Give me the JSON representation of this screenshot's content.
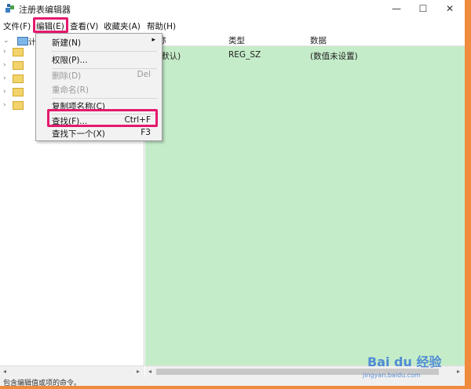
{
  "window": {
    "title": "注册表编辑器",
    "controls": {
      "minimize": "—",
      "maximize": "☐",
      "close": "✕"
    }
  },
  "menubar": {
    "file": "文件(F)",
    "edit": "编辑(E)",
    "view": "查看(V)",
    "favorites": "收藏夹(A)",
    "help": "帮助(H)"
  },
  "tree": {
    "root_label": "计",
    "expand_glyph": "›",
    "collapse_glyph": "⌄"
  },
  "list": {
    "headers": {
      "name": "称",
      "type": "类型",
      "data": "数据"
    },
    "rows": [
      {
        "name": "(默认)",
        "type": "REG_SZ",
        "data": "(数值未设置)"
      }
    ]
  },
  "edit_menu": {
    "items": [
      {
        "label": "新建(N)",
        "shortcut": "",
        "submenu_glyph": "▸"
      },
      {
        "label": "权限(P)...",
        "shortcut": ""
      },
      {
        "label": "删除(D)",
        "shortcut": "Del"
      },
      {
        "label": "重命名(R)",
        "shortcut": ""
      },
      {
        "label": "复制项名称(C)",
        "shortcut": ""
      },
      {
        "label": "查找(F)...",
        "shortcut": "Ctrl+F"
      },
      {
        "label": "查找下一个(X)",
        "shortcut": "F3"
      }
    ]
  },
  "scroll_arrows": {
    "left": "◂",
    "right": "▸"
  },
  "status": {
    "text": "包含编辑值或项的命令。"
  },
  "watermark": {
    "text": "Bai du 经验",
    "url": "jingyan.baidu.com"
  },
  "colors": {
    "highlight_border": "#e5196e",
    "value_pane_bg": "#c5ecc9",
    "frame": "#f08a3c"
  }
}
